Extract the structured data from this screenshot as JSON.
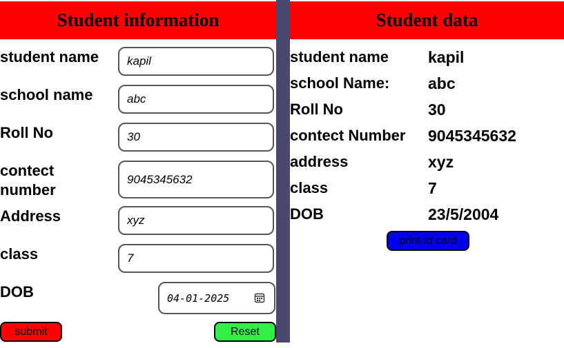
{
  "form": {
    "title": "Student information",
    "fields": [
      {
        "label": "student name",
        "value": "kapil"
      },
      {
        "label": "school name",
        "value": "abc"
      },
      {
        "label": "Roll No",
        "value": "30"
      },
      {
        "label": "contect number",
        "value": "9045345632"
      },
      {
        "label": "Address",
        "value": "xyz"
      },
      {
        "label": "class",
        "value": "7"
      }
    ],
    "dob": {
      "label": "DOB",
      "value": "04-01-2025"
    },
    "submit_label": "submit",
    "reset_label": "Reset",
    "colors": {
      "submit": "#ff0000",
      "reset": "#33ee44",
      "banner": "#ff0000"
    }
  },
  "data_panel": {
    "title": "Student data",
    "rows": [
      {
        "label": "student name",
        "value": "kapil"
      },
      {
        "label": "school Name:",
        "value": "abc"
      },
      {
        "label": "Roll No",
        "value": "30"
      },
      {
        "label": "contect Number",
        "value": "9045345632"
      },
      {
        "label": "address",
        "value": "xyz"
      },
      {
        "label": "class",
        "value": "7"
      },
      {
        "label": "DOB",
        "value": "23/5/2004"
      }
    ],
    "print_label": "print id card",
    "colors": {
      "print": "#0000ee",
      "divider": "#4a4870"
    }
  }
}
